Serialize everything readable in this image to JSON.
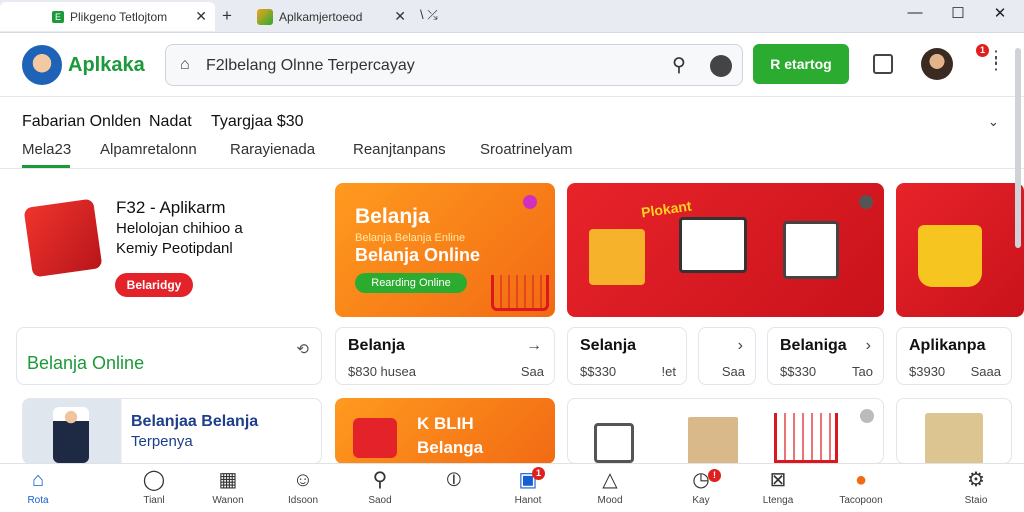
{
  "browser": {
    "tab1_title": "Plikgeno Tetlojtom",
    "tab2_title": "Aplkamjertoeod",
    "tab_icon_label": "E",
    "min_label": "—",
    "max_label": "☐",
    "close_label": "✕"
  },
  "header": {
    "brand": "Aplkaka",
    "search_text": "F2lbelang Olnne Terpercayay",
    "cta_label": "R etartog",
    "notif_count": "1"
  },
  "subheader": {
    "item1": "Fabarian Onlden",
    "item2": "Nadat",
    "item3": "Tyargjaa $30",
    "tabs": [
      "Mela23",
      "Alpamretalonn",
      "Rarayienada",
      "Reanjtanpans",
      "Sroatrinelyam"
    ]
  },
  "promo": {
    "title": "F32 - Aplikarm",
    "line2": "Helolojan chihioo a",
    "line3": "Kemiy Peotipdanl",
    "button": "Belaridgy"
  },
  "banner_orange": {
    "title": "Belanja",
    "subtitle": "Belanja Belanja Enline",
    "big": "Belanja Online",
    "button": "Rearding Online"
  },
  "banner_red": {
    "label": "Plokant"
  },
  "small_cards": [
    {
      "title": "Belanja Online"
    },
    {
      "title": "Belanja",
      "price": "$830 husea",
      "meta": "Saa"
    },
    {
      "title": "Selanja",
      "price": "$$330",
      "meta": "!et"
    },
    {
      "title": "",
      "price": "",
      "meta": "Saa"
    },
    {
      "title": "Belaniga",
      "price": "$$330",
      "meta": "Tao"
    },
    {
      "title": "Aplikanpa",
      "price": "$3930",
      "meta": "Saaa"
    }
  ],
  "bottom_row": {
    "card1_title": "Belanjaa Belanja",
    "card1_sub": "Terpenya",
    "card2_title": "K BLIH",
    "card2_sub": "Belanga"
  },
  "bottom_nav": [
    {
      "label": "Rota",
      "icon": "home-icon"
    },
    {
      "label": "Tianl",
      "icon": "chat-icon"
    },
    {
      "label": "Wanon",
      "icon": "grid-icon"
    },
    {
      "label": "Idsoon",
      "icon": "people-icon"
    },
    {
      "label": "Saod",
      "icon": "search-icon"
    },
    {
      "label": "",
      "icon": "compass-icon"
    },
    {
      "label": "Hanot",
      "icon": "inbox-icon"
    },
    {
      "label": "Mood",
      "icon": "triangle-icon"
    },
    {
      "label": "Kay",
      "icon": "clock-icon"
    },
    {
      "label": "Ltenga",
      "icon": "image-icon"
    },
    {
      "label": "Tacopoon",
      "icon": "coupon-icon"
    },
    {
      "label": "Staio",
      "icon": "settings-icon"
    }
  ],
  "bottom_badges": {
    "hanot": "1",
    "kay": "!"
  },
  "colors": {
    "brand_green": "#1b9a3a",
    "cta_green": "#2bab2f",
    "red": "#e8232a",
    "orange": "#f57a16"
  }
}
